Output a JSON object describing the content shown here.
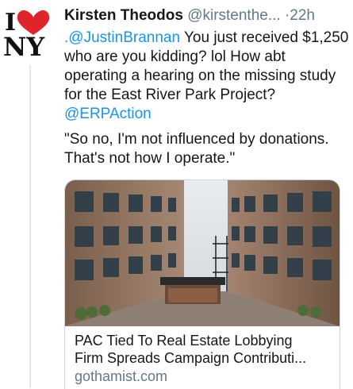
{
  "tweet": {
    "author_name": "Kirsten Theodos",
    "author_handle": "@kirstenthe...",
    "separator": "·",
    "time": "22h",
    "avatar_logo_text": "I ♥ NY",
    "body": {
      "line1_mention": ".@JustinBrannan",
      "line1_text": " You just received $1,250 who are you kidding? lol How abt operating a hearing on the missing study for the East River Park Project? ",
      "line1_mention2": "@ERPAction",
      "quote": "\"So no, I'm not influenced by donations. That's not how I operate.\""
    },
    "link_card": {
      "title_line1": "PAC Tied To Real Estate Lobbying",
      "title_line2": "Firm Spreads Campaign Contributi...",
      "domain": "gothamist.com",
      "image_desc_name": "courtyard-between-brick-buildings"
    }
  },
  "colors": {
    "text": "#14171a",
    "secondary": "#657786",
    "link": "#1b95e0",
    "border": "#ccd6dd"
  }
}
